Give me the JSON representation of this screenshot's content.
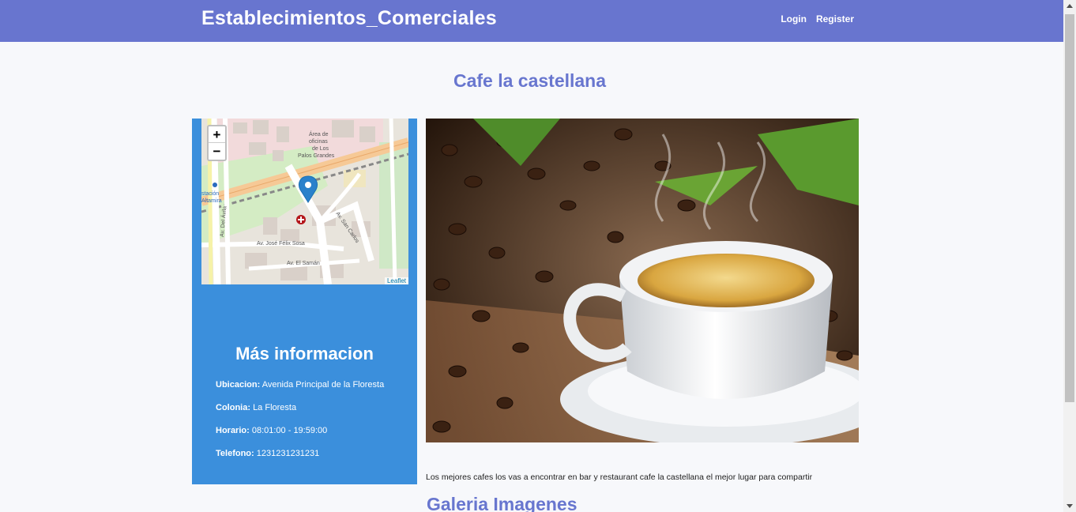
{
  "navbar": {
    "brand": "Establecimientos_Comerciales",
    "links": [
      "Login",
      "Register"
    ]
  },
  "page": {
    "title": "Cafe la castellana"
  },
  "map": {
    "zoom_in": "+",
    "zoom_out": "−",
    "attribution": "Leaflet",
    "labels": [
      "Área de oficinas de Los Palos Grandes",
      "Av. San Carlos",
      "Av. José Félix Sosa",
      "Av. El Samán",
      "Av. Del Ávila",
      "Estación Altamira"
    ]
  },
  "info": {
    "title": "Más informacion",
    "ubicacion_label": "Ubicacion:",
    "ubicacion_value": "Avenida Principal de la Floresta",
    "colonia_label": "Colonia:",
    "colonia_value": "La Floresta",
    "horario_label": "Horario:",
    "horario_value": "08:01:00 - 19:59:00",
    "telefono_label": "Telefono:",
    "telefono_value": "1231231231231"
  },
  "description": "Los mejores cafes los vas a encontrar en bar y restaurant cafe la castellana el mejor lugar para compartir",
  "gallery": {
    "title": "Galeria Imagenes"
  },
  "colors": {
    "navbar": "#6875cf",
    "accent": "#6876cf",
    "panel": "#3b8fdc"
  }
}
